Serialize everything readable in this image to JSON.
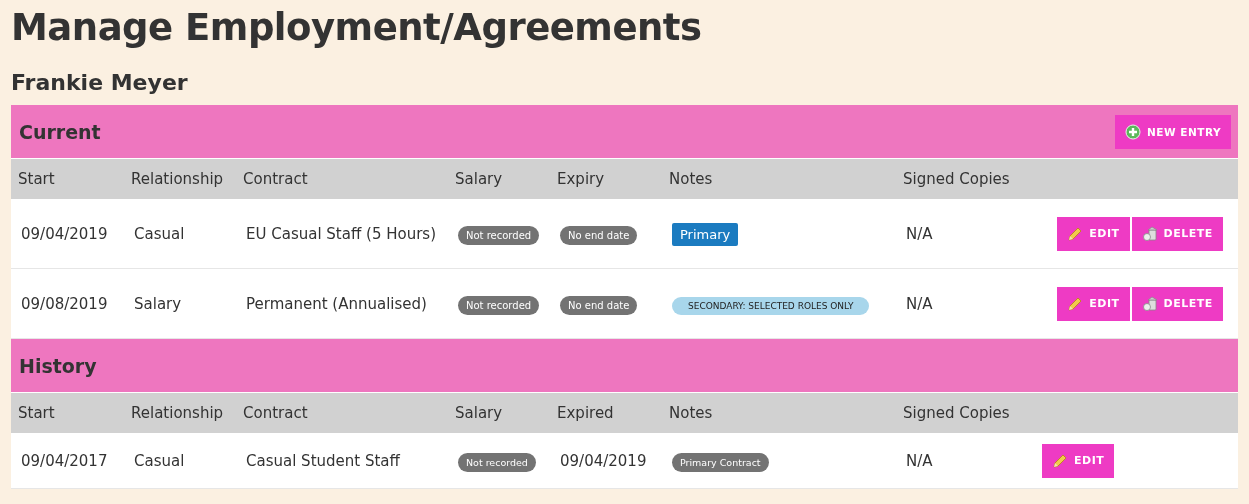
{
  "title": "Manage Employment/Agreements",
  "person": "Frankie Meyer",
  "sections": [
    {
      "heading": "Current",
      "action": {
        "label": "NEW ENTRY"
      },
      "columns": [
        "Start",
        "Relationship",
        "Contract",
        "Salary",
        "Expiry",
        "Notes",
        "Signed Copies"
      ],
      "rows": [
        {
          "cells": [
            {
              "kind": "text",
              "text": "09/04/2019"
            },
            {
              "kind": "text",
              "text": "Casual"
            },
            {
              "kind": "text",
              "text": "EU Casual Staff (5 Hours)"
            },
            {
              "kind": "pill",
              "text": "Not recorded"
            },
            {
              "kind": "pill",
              "text": "No end date"
            },
            {
              "kind": "primary",
              "text": "Primary"
            },
            {
              "kind": "text",
              "text": "N/A"
            }
          ],
          "actions": [
            {
              "kind": "edit",
              "label": "EDIT"
            },
            {
              "kind": "delete",
              "label": "DELETE"
            }
          ]
        },
        {
          "cells": [
            {
              "kind": "text",
              "text": "09/08/2019"
            },
            {
              "kind": "text",
              "text": "Salary"
            },
            {
              "kind": "text",
              "text": "Permanent (Annualised)"
            },
            {
              "kind": "pill",
              "text": "Not recorded"
            },
            {
              "kind": "pill",
              "text": "No end date"
            },
            {
              "kind": "secondary",
              "text": "SECONDARY: SELECTED ROLES ONLY"
            },
            {
              "kind": "text",
              "text": "N/A"
            }
          ],
          "actions": [
            {
              "kind": "edit",
              "label": "EDIT"
            },
            {
              "kind": "delete",
              "label": "DELETE"
            }
          ]
        }
      ]
    },
    {
      "heading": "History",
      "columns": [
        "Start",
        "Relationship",
        "Contract",
        "Salary",
        "Expired",
        "Notes",
        "Signed Copies"
      ],
      "rows": [
        {
          "cells": [
            {
              "kind": "text",
              "text": "09/04/2017"
            },
            {
              "kind": "text",
              "text": "Casual"
            },
            {
              "kind": "text",
              "text": "Casual Student Staff"
            },
            {
              "kind": "pill",
              "text": "Not recorded"
            },
            {
              "kind": "text",
              "text": "09/04/2019"
            },
            {
              "kind": "pill",
              "text": "Primary Contract"
            },
            {
              "kind": "text",
              "text": "N/A"
            }
          ],
          "actions": [
            {
              "kind": "edit",
              "label": "EDIT"
            }
          ]
        }
      ]
    }
  ]
}
